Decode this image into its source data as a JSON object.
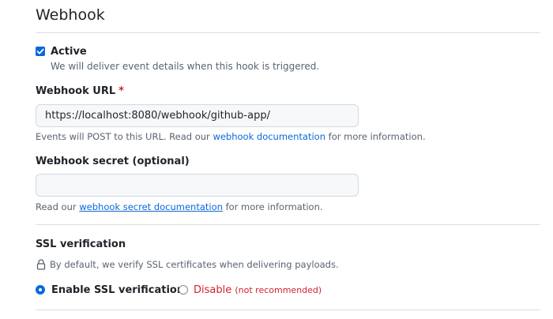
{
  "section": {
    "title": "Webhook"
  },
  "active": {
    "checked": true,
    "label": "Active",
    "description": "We will deliver event details when this hook is triggered."
  },
  "webhook_url": {
    "label": "Webhook URL",
    "required_marker": "*",
    "value": "https://localhost:8080/webhook/github-app/",
    "note_prefix": "Events will POST to this URL. Read our ",
    "note_link": "webhook documentation",
    "note_suffix": " for more information."
  },
  "webhook_secret": {
    "label": "Webhook secret (optional)",
    "value": "",
    "note_prefix": "Read our ",
    "note_link": "webhook secret documentation",
    "note_suffix": " for more information."
  },
  "ssl": {
    "label": "SSL verification",
    "lock_icon": "lock-icon",
    "description": "By default, we verify SSL certificates when delivering payloads.",
    "options": [
      {
        "label": "Enable SSL verification",
        "selected": true
      },
      {
        "label": "Disable",
        "hint": "(not recommended)",
        "selected": false
      }
    ]
  },
  "colors": {
    "accent": "#0969da",
    "danger": "#d1242f",
    "muted": "#59636e",
    "border": "#d8dee4"
  }
}
